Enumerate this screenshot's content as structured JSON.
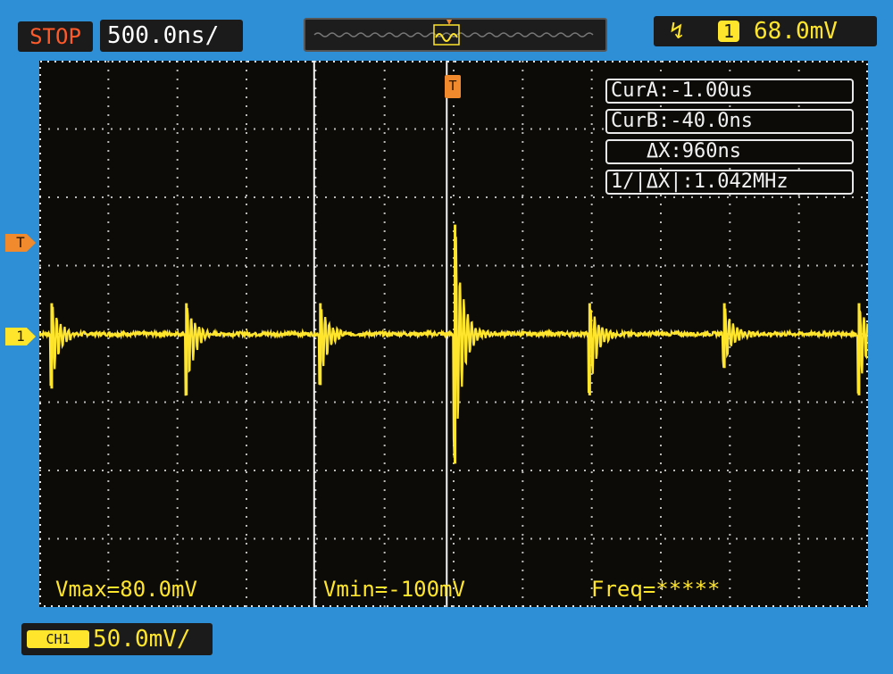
{
  "status": {
    "run_state": "STOP",
    "timebase": "500.0ns/",
    "memory_icon": "waveform-memory-bar-icon",
    "trigger_edge_icon": "rising-edge-icon",
    "trigger_source": "1",
    "trigger_level": "68.0mV"
  },
  "markers": {
    "trigger_level": "T",
    "channel1": "1",
    "trigger_position": "T"
  },
  "cursors": {
    "cur_a": "CurA:-1.00us",
    "cur_b": "CurB:-40.0ns",
    "delta_x": "ΔX:960ns",
    "inv_delta_x": "1/|ΔX|:1.042MHz"
  },
  "measurements": {
    "vmax": "Vmax=80.0mV",
    "vmin": "Vmin=-100mV",
    "freq": "Freq=*****"
  },
  "channel": {
    "icon": "CH1",
    "scale": "50.0mV/"
  },
  "colors": {
    "trace": "#ffe52c",
    "trigger": "#f08a2c",
    "grid": "#e6e6e6",
    "screen": "#0c0b08",
    "bezel": "#2f8fd6"
  },
  "chart_data": {
    "type": "line",
    "title": "",
    "xlabel": "",
    "ylabel": "",
    "x_units": "div",
    "y_units": "div",
    "xlim": [
      0,
      12
    ],
    "ylim": [
      -4,
      4
    ],
    "grid": true,
    "pulse_times_div": [
      0.18,
      2.13,
      4.07,
      6.02,
      7.97,
      9.92,
      11.87
    ],
    "pulse_peaks_div": [
      0.45,
      0.45,
      0.45,
      1.6,
      0.45,
      0.45,
      0.45
    ],
    "pulse_troughs_div": [
      -0.8,
      -0.9,
      -0.75,
      -1.9,
      -0.9,
      -0.5,
      -0.9
    ],
    "baseline_div": 0,
    "cursor_a_div": 3.98,
    "cursor_b_div": 5.9
  }
}
